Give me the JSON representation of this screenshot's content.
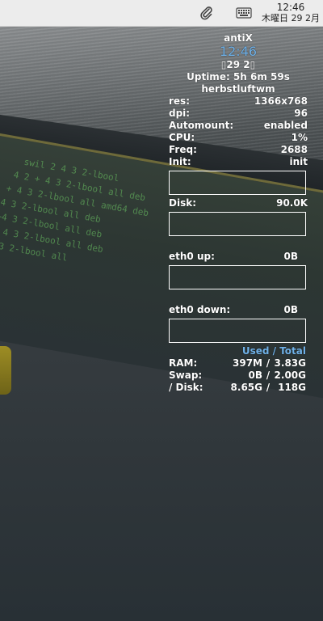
{
  "panel": {
    "time": "12:46",
    "date": "木曜日 29 2月",
    "tray_icons": [
      "paperclip-icon",
      "keyboard-icon"
    ]
  },
  "conky": {
    "hostname": "antiX",
    "clock": "12:46",
    "date_short": "▯29 2▯",
    "uptime": "Uptime: 5h 6m 59s",
    "wm": "herbstluftwm",
    "info": [
      {
        "label": "res:",
        "value": "1366x768"
      },
      {
        "label": "dpi:",
        "value": "96"
      },
      {
        "label": "Automount:",
        "value": "enabled"
      },
      {
        "label": "CPU:",
        "value": "1%"
      },
      {
        "label": "Freq:",
        "value": "2688"
      },
      {
        "label": "Init:",
        "value": "init"
      }
    ],
    "disk": {
      "label": "Disk:",
      "value": "90.0K"
    },
    "eth_up": {
      "label": "eth0 up:",
      "value": "0B"
    },
    "eth_down": {
      "label": "eth0 down:",
      "value": "0B"
    },
    "mem_header": "Used / Total",
    "mem": [
      {
        "label": "RAM:",
        "used": "397M",
        "sep": "/",
        "total": "3.83G"
      },
      {
        "label": "Swap:",
        "used": "0B",
        "sep": "/",
        "total": "2.00G"
      },
      {
        "label": "/ Disk:",
        "used": "8.65G",
        "sep": "/",
        "total": "118G"
      }
    ],
    "accent_color": "#6fb1e8"
  }
}
